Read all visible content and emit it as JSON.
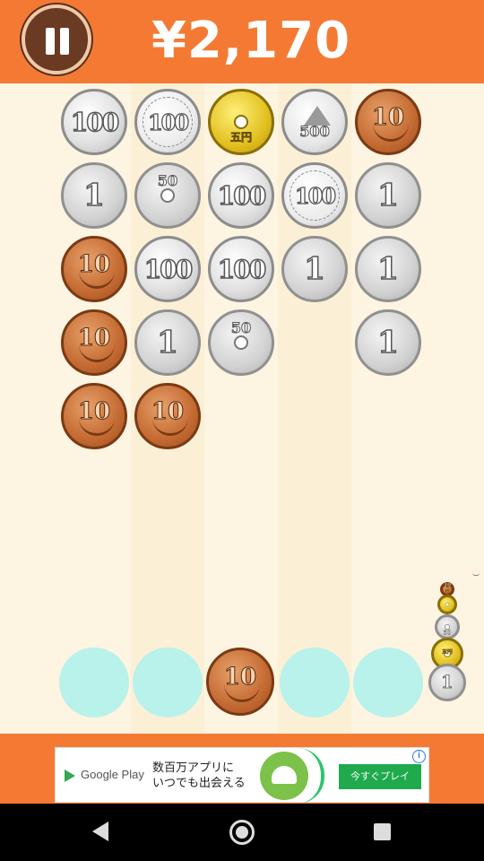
{
  "header": {
    "score": "¥2,170",
    "pause_icon": "pause-icon",
    "background_color": "#f47a33"
  },
  "coin_labels": {
    "c100": "100",
    "c100o": "100",
    "c1": "1",
    "c10": "10",
    "c50": "50",
    "c5": "五円",
    "c500": "500"
  },
  "board": {
    "columns": [
      [
        "c100",
        "c1",
        "c10",
        "c10",
        "c10"
      ],
      [
        "c100o",
        "c50",
        "c100",
        "c1",
        "c10"
      ],
      [
        "c5",
        "c100",
        "c100",
        "c50"
      ],
      [
        "c500",
        "c100o",
        "c1"
      ],
      [
        "c10",
        "c1",
        "c1",
        "c1"
      ]
    ]
  },
  "launcher": {
    "slots": [
      "",
      "",
      "c10",
      "",
      ""
    ]
  },
  "next_queue": [
    "c10",
    "c5",
    "c50",
    "c5",
    "c1"
  ],
  "ad": {
    "store_label": "Google Play",
    "text_line1": "数百万アプリに",
    "text_line2": "いつでも出会える",
    "cta_label": "今すぐプレイ",
    "info_label": "i"
  },
  "navbar": {
    "back_icon": "back-icon",
    "home_icon": "home-icon",
    "recent_icon": "recent-apps-icon"
  }
}
